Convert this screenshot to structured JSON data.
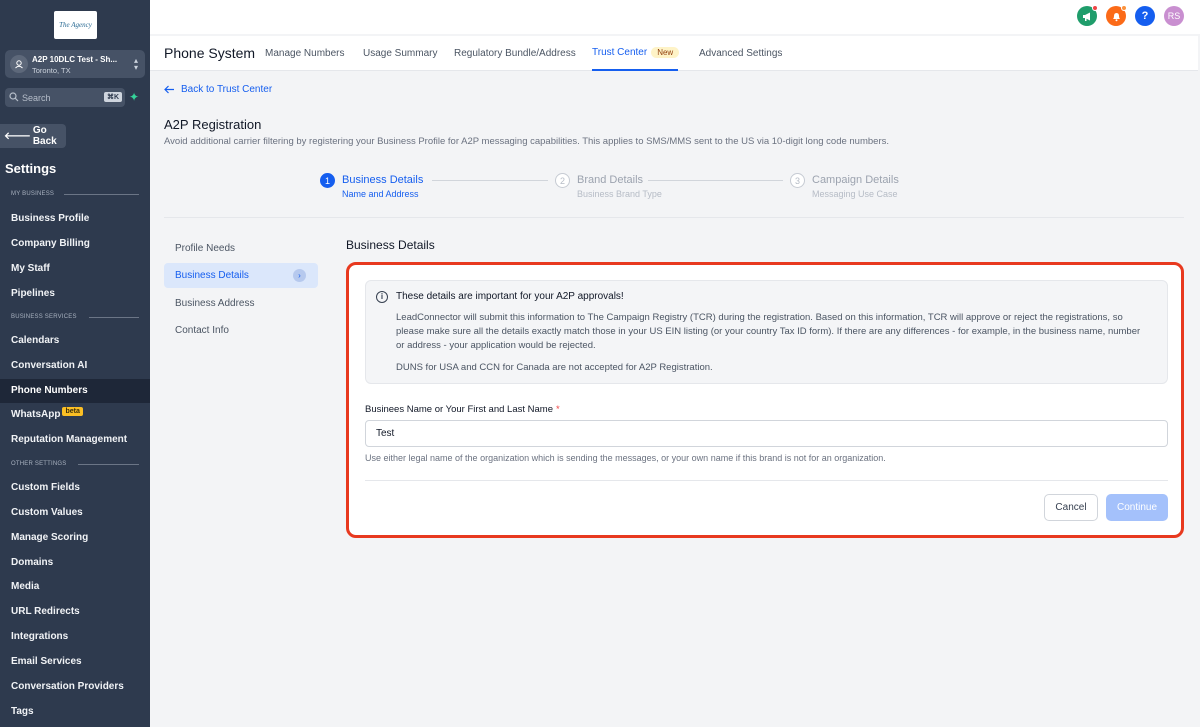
{
  "sidebar": {
    "logo_text": "The Agency",
    "location": {
      "name": "A2P 10DLC Test - Sh...",
      "city": "Toronto, TX"
    },
    "search_placeholder": "Search",
    "search_shortcut": "⌘K",
    "go_back": "Go Back",
    "settings_title": "Settings",
    "sections": {
      "my_business": "MY BUSINESS",
      "business_services": "BUSINESS SERVICES",
      "other_settings": "OTHER SETTINGS"
    },
    "items": [
      {
        "label": "Business Profile"
      },
      {
        "label": "Company Billing"
      },
      {
        "label": "My Staff"
      },
      {
        "label": "Pipelines"
      },
      {
        "label": "Calendars"
      },
      {
        "label": "Conversation AI"
      },
      {
        "label": "Phone Numbers",
        "active": true
      },
      {
        "label": "WhatsApp",
        "badge": "beta"
      },
      {
        "label": "Reputation Management"
      },
      {
        "label": "Custom Fields"
      },
      {
        "label": "Custom Values"
      },
      {
        "label": "Manage Scoring"
      },
      {
        "label": "Domains"
      },
      {
        "label": "Media"
      },
      {
        "label": "URL Redirects"
      },
      {
        "label": "Integrations"
      },
      {
        "label": "Email Services"
      },
      {
        "label": "Conversation Providers"
      },
      {
        "label": "Tags"
      }
    ]
  },
  "header": {
    "avatar_initials": "RS",
    "help_symbol": "?",
    "colors": {
      "announce": "#1f9d6b",
      "notify": "#fb6a18",
      "help": "#155eef",
      "avatar": "#c98fd0"
    }
  },
  "tabs": {
    "section_title": "Phone System",
    "items": [
      {
        "label": "Manage Numbers"
      },
      {
        "label": "Usage Summary"
      },
      {
        "label": "Regulatory Bundle/Address"
      },
      {
        "label": "Trust Center",
        "badge": "New",
        "active": true
      },
      {
        "label": "Advanced Settings"
      }
    ]
  },
  "main": {
    "back_link": "Back to Trust Center",
    "title": "A2P Registration",
    "subtitle": "Avoid additional carrier filtering by registering your Business Profile for A2P messaging capabilities. This applies to SMS/MMS sent to the US via 10-digit long code numbers.",
    "steps": [
      {
        "num": "1",
        "title": "Business Details",
        "sub": "Name and Address",
        "active": true
      },
      {
        "num": "2",
        "title": "Brand Details",
        "sub": "Business Brand Type",
        "active": false
      },
      {
        "num": "3",
        "title": "Campaign Details",
        "sub": "Messaging Use Case",
        "active": false
      }
    ],
    "left_nav": [
      {
        "label": "Profile Needs"
      },
      {
        "label": "Business Details",
        "active": true
      },
      {
        "label": "Business Address"
      },
      {
        "label": "Contact Info"
      }
    ],
    "section_title": "Business Details",
    "info": {
      "title": "These details are important for your A2P approvals!",
      "body": "LeadConnector will submit this information to The Campaign Registry (TCR) during the registration. Based on this information, TCR will approve or reject the registrations, so please make sure all the details exactly match those in your US EIN listing (or your country Tax ID form). If there are any differences - for example, in the business name, number or address - your application would be rejected.",
      "note": "DUNS for USA and CCN for Canada are not accepted for A2P Registration."
    },
    "field": {
      "label": "Businees Name or Your First and Last Name",
      "required_mark": "*",
      "value": "Test",
      "help": "Use either legal name of the organization which is sending the messages, or your own name if this brand is not for an organization."
    },
    "buttons": {
      "cancel": "Cancel",
      "continue": "Continue"
    },
    "highlight_color": "#e8391f"
  }
}
